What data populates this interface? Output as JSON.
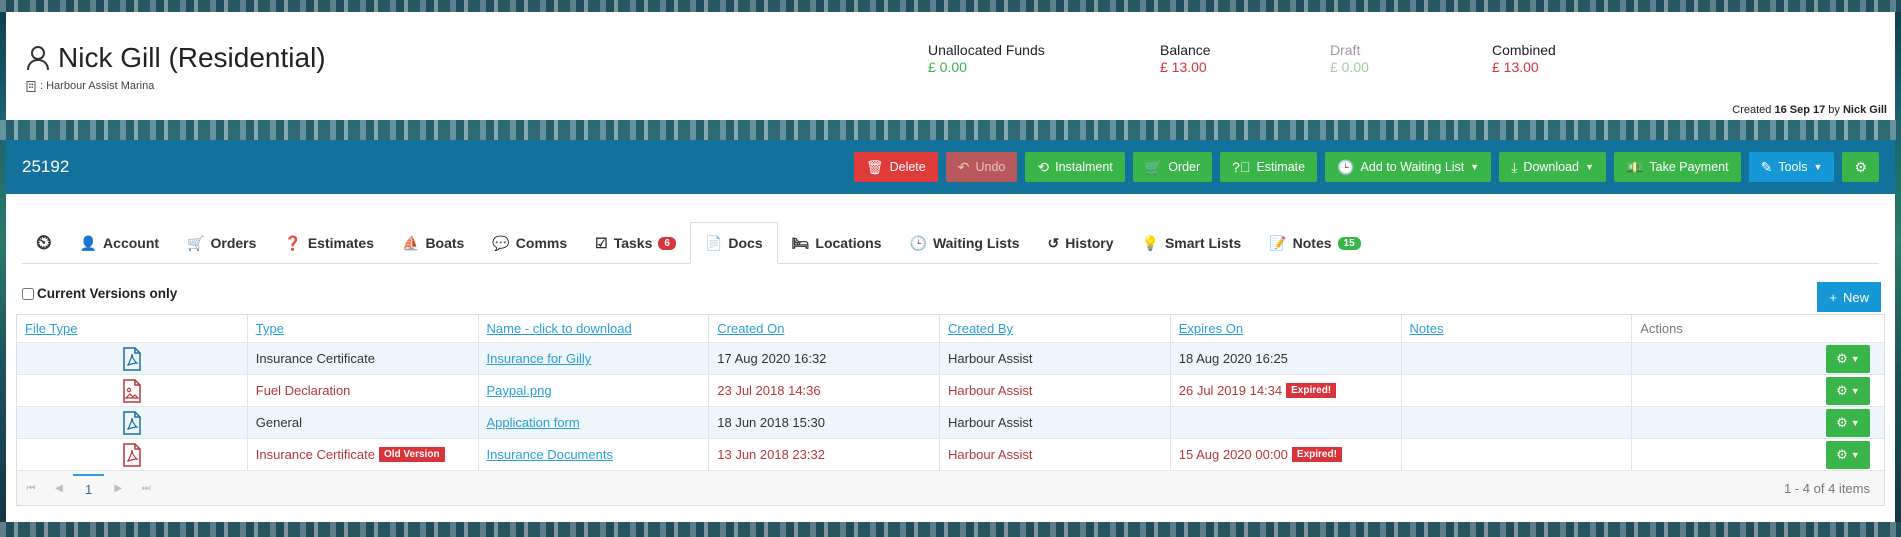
{
  "customer": {
    "name": "Nick Gill (Residential)",
    "marina": ": Harbour Assist Marina",
    "created_prefix": "Created",
    "created_date": "16 Sep 17",
    "created_by_prefix": "by",
    "created_by": "Nick Gill"
  },
  "funds": [
    {
      "label": "Unallocated Funds",
      "value": "£ 0.00"
    },
    {
      "label": "Balance",
      "value": "£ 13.00"
    },
    {
      "label": "Draft",
      "value": "£ 0.00"
    },
    {
      "label": "Combined",
      "value": "£ 13.00"
    }
  ],
  "account_number": "25192",
  "toolbar": {
    "delete": "Delete",
    "undo": "Undo",
    "instalment": "Instalment",
    "order": "Order",
    "estimate": "Estimate",
    "waiting_list": "Add to Waiting List",
    "download": "Download",
    "take_payment": "Take Payment",
    "tools": "Tools"
  },
  "tabs": [
    {
      "label": ""
    },
    {
      "label": "Account"
    },
    {
      "label": "Orders"
    },
    {
      "label": "Estimates"
    },
    {
      "label": "Boats"
    },
    {
      "label": "Comms"
    },
    {
      "label": "Tasks",
      "count": "6"
    },
    {
      "label": "Docs"
    },
    {
      "label": "Locations"
    },
    {
      "label": "Waiting Lists"
    },
    {
      "label": "History"
    },
    {
      "label": "Smart Lists"
    },
    {
      "label": "Notes",
      "count": "15"
    }
  ],
  "docs": {
    "current_versions_label": "Current Versions only",
    "new_label": "New",
    "columns": [
      "File Type",
      "Type",
      "Name - click to download",
      "Created On",
      "Created By",
      "Expires On",
      "Notes",
      "Actions"
    ],
    "rows": [
      {
        "file_icon": "pdf-icon",
        "type": "Insurance Certificate",
        "type_tag": "",
        "name": "Insurance for Gilly",
        "created_on": "17 Aug 2020 16:32",
        "created_by": "Harbour Assist",
        "expires_on": "18 Aug 2020 16:25",
        "expires_tag": "",
        "notes": ""
      },
      {
        "file_icon": "image-file-icon",
        "type": "Fuel Declaration",
        "type_tag": "",
        "name": "Paypal.png",
        "created_on": "23 Jul 2018 14:36",
        "created_by": "Harbour Assist",
        "expires_on": "26 Jul 2019 14:34",
        "expires_tag": "Expired!",
        "notes": ""
      },
      {
        "file_icon": "pdf-icon",
        "type": "General",
        "type_tag": "",
        "name": "Application form",
        "created_on": "18 Jun 2018 15:30",
        "created_by": "Harbour Assist",
        "expires_on": "",
        "expires_tag": "",
        "notes": ""
      },
      {
        "file_icon": "pdf-icon",
        "type": "Insurance Certificate",
        "type_tag": "Old Version",
        "name": "Insurance Documents",
        "created_on": "13 Jun 2018 23:32",
        "created_by": "Harbour Assist",
        "expires_on": "15 Aug 2020 00:00",
        "expires_tag": "Expired!",
        "notes": ""
      }
    ],
    "pager": {
      "current_page": "1",
      "info": "1 - 4 of 4 items"
    }
  },
  "colors": {
    "primary_bar": "#13729b",
    "green": "#3ab54a",
    "red": "#d9343a",
    "blue": "#1697d6"
  }
}
